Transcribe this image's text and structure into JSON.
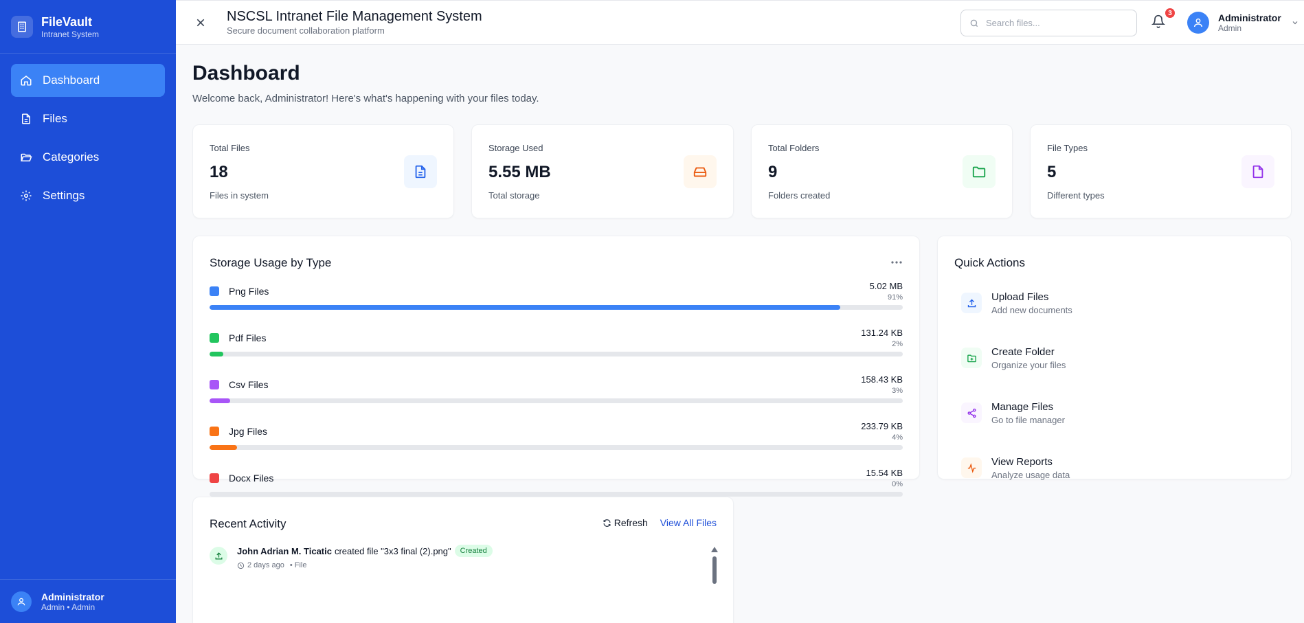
{
  "brand": {
    "name": "FileVault",
    "subtitle": "Intranet System"
  },
  "sidebar": {
    "items": [
      {
        "label": "Dashboard",
        "icon": "home-icon",
        "active": true
      },
      {
        "label": "Files",
        "icon": "file-icon"
      },
      {
        "label": "Categories",
        "icon": "folder-open-icon"
      },
      {
        "label": "Settings",
        "icon": "gear-icon"
      }
    ],
    "footer": {
      "name": "Administrator",
      "role": "Admin • Admin"
    }
  },
  "header": {
    "title": "NSCSL Intranet File Management System",
    "subtitle": "Secure document collaboration platform",
    "search_placeholder": "Search files...",
    "notification_count": "3",
    "user_name": "Administrator",
    "user_role": "Admin"
  },
  "page": {
    "title": "Dashboard",
    "subtitle": "Welcome back, Administrator! Here's what's happening with your files today."
  },
  "stats": [
    {
      "label": "Total Files",
      "value": "18",
      "note": "Files in system",
      "icon": "document-icon",
      "color": "#2563eb",
      "bg": "#eff6ff"
    },
    {
      "label": "Storage Used",
      "value": "5.55 MB",
      "note": "Total storage",
      "icon": "hard-drive-icon",
      "color": "#ea580c",
      "bg": "#fff7ed"
    },
    {
      "label": "Total Folders",
      "value": "9",
      "note": "Folders created",
      "icon": "folder-icon",
      "color": "#16a34a",
      "bg": "#f0fdf4"
    },
    {
      "label": "File Types",
      "value": "5",
      "note": "Different types",
      "icon": "file-icon",
      "color": "#9333ea",
      "bg": "#faf5ff"
    }
  ],
  "storage": {
    "title": "Storage Usage by Type",
    "rows": [
      {
        "name": "Png Files",
        "size": "5.02 MB",
        "pct": "91%",
        "fill": 0.91,
        "color": "#3b82f6"
      },
      {
        "name": "Pdf Files",
        "size": "131.24 KB",
        "pct": "2%",
        "fill": 0.02,
        "color": "#22c55e"
      },
      {
        "name": "Csv Files",
        "size": "158.43 KB",
        "pct": "3%",
        "fill": 0.03,
        "color": "#a855f7"
      },
      {
        "name": "Jpg Files",
        "size": "233.79 KB",
        "pct": "4%",
        "fill": 0.04,
        "color": "#f97316"
      },
      {
        "name": "Docx Files",
        "size": "15.54 KB",
        "pct": "0%",
        "fill": 0.0,
        "color": "#ef4444"
      }
    ]
  },
  "quick_actions": {
    "title": "Quick Actions",
    "items": [
      {
        "title": "Upload Files",
        "sub": "Add new documents",
        "icon": "upload-icon",
        "color": "#2563eb",
        "bg": "#eff6ff"
      },
      {
        "title": "Create Folder",
        "sub": "Organize your files",
        "icon": "folder-plus-icon",
        "color": "#16a34a",
        "bg": "#f0fdf4"
      },
      {
        "title": "Manage Files",
        "sub": "Go to file manager",
        "icon": "share-icon",
        "color": "#9333ea",
        "bg": "#faf5ff"
      },
      {
        "title": "View Reports",
        "sub": "Analyze usage data",
        "icon": "activity-icon",
        "color": "#ea580c",
        "bg": "#fff7ed"
      }
    ]
  },
  "recent": {
    "title": "Recent Activity",
    "refresh_label": "Refresh",
    "view_all_label": "View All Files",
    "items": [
      {
        "user": "John Adrian M. Ticatic",
        "action": "created file \"3x3 final (2).png\"",
        "badge": "Created",
        "time": "2 days ago",
        "type": "• File"
      }
    ]
  }
}
